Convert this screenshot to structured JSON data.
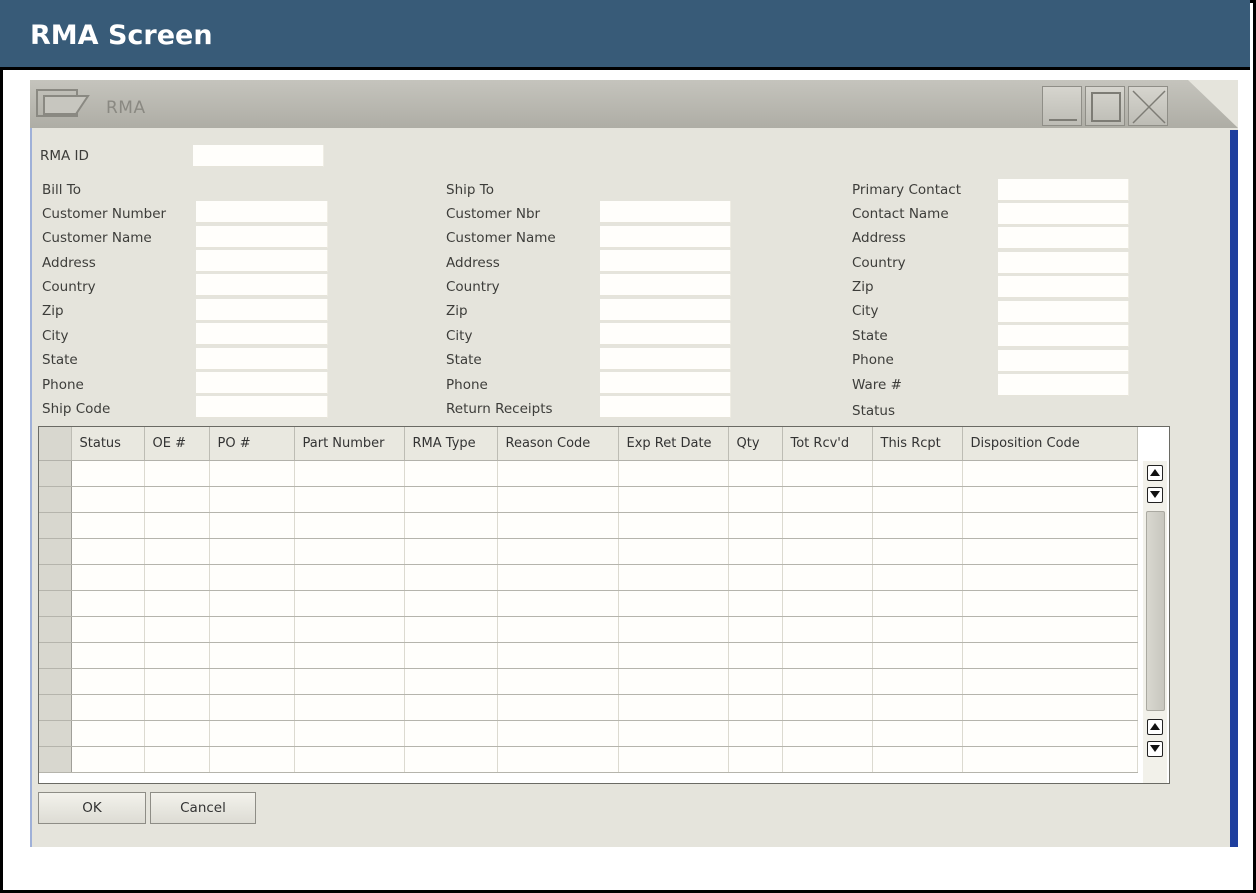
{
  "banner": {
    "title": "RMA Screen"
  },
  "window": {
    "title": "RMA"
  },
  "rma_id_label": "RMA ID",
  "bill_to": {
    "heading": "Bill To",
    "labels": [
      "Customer Number",
      "Customer Name",
      "Address",
      "Country",
      "Zip",
      "City",
      "State",
      "Phone",
      "Ship Code"
    ]
  },
  "ship_to": {
    "heading": "Ship To",
    "labels": [
      "Customer Nbr",
      "Customer Name",
      "Address",
      "Country",
      "Zip",
      "City",
      "State",
      "Phone",
      "Return Receipts"
    ]
  },
  "contact": {
    "labels": [
      "Primary Contact",
      "Contact Name",
      "Address",
      "Country",
      "Zip",
      "City",
      "State",
      "Phone",
      "Ware #",
      "Status"
    ]
  },
  "grid": {
    "columns": [
      "Status",
      "OE #",
      "PO #",
      "Part Number",
      "RMA Type",
      "Reason Code",
      "Exp Ret Date",
      "Qty",
      "Tot Rcv'd",
      "This Rcpt",
      "Disposition Code"
    ]
  },
  "buttons": {
    "ok": "OK",
    "cancel": "Cancel"
  }
}
